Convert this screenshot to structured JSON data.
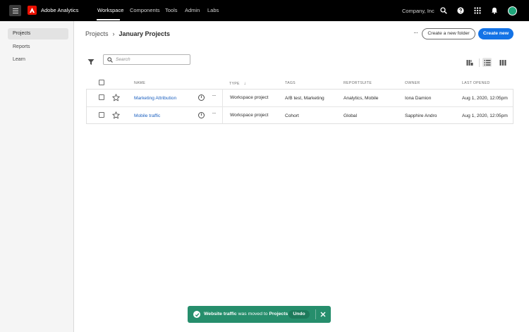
{
  "topbar": {
    "app_title": "Adobe Analytics",
    "nav": [
      "Workspace",
      "Components",
      "Tools",
      "Admin",
      "Labs"
    ],
    "active_nav": "Workspace",
    "company": "Company, Inc",
    "icons": [
      "search-icon",
      "help-icon",
      "apps-grid-icon",
      "notifications-bell-icon",
      "user-avatar"
    ]
  },
  "sidebar": {
    "items": [
      {
        "label": "Projects",
        "selected": true
      },
      {
        "label": "Reports",
        "selected": false
      },
      {
        "label": "Learn",
        "selected": false
      }
    ]
  },
  "breadcrumb": {
    "parent": "Projects",
    "separator": "›",
    "current": "January Projects"
  },
  "actions": {
    "more": "···",
    "create_folder": "Create a new folder",
    "create_new": "Create new"
  },
  "search": {
    "placeholder": "Search",
    "value": ""
  },
  "view_toggle": {
    "options": [
      "card-view-icon",
      "list-view-icon",
      "column-view-icon"
    ],
    "active": "list-view-icon"
  },
  "table": {
    "columns": {
      "name": "NAME",
      "type": "TYPE",
      "type_sort": "↓",
      "tags": "TAGS",
      "reportsuite": "REPORTSUITE",
      "owner": "OWNER",
      "last_opened": "LAST OPENED"
    },
    "rows": [
      {
        "name": "Marketing Attribution",
        "type": "Workspace project",
        "tags": "A/B test, Marketing",
        "reportsuite": "Analytics, Mobile",
        "owner": "Iona Damion",
        "last_opened": "Aug 1, 2020, 12:05pm"
      },
      {
        "name": "Mobile traffic",
        "type": "Workspace project",
        "tags": "Cohort",
        "reportsuite": "Global",
        "owner": "Sapphire Andro",
        "last_opened": "Aug 1, 2020, 12:05pm"
      }
    ],
    "info_glyph": "i",
    "more_glyph": "···"
  },
  "toast": {
    "item": "Website traffic",
    "middle": " was moved to ",
    "destination": "Projects",
    "undo": "Undo",
    "color": "#268e6c"
  },
  "colors": {
    "accent": "#1473e6",
    "topbar": "#000000",
    "adobe_red": "#eb1000",
    "link": "#1a5fbf"
  }
}
